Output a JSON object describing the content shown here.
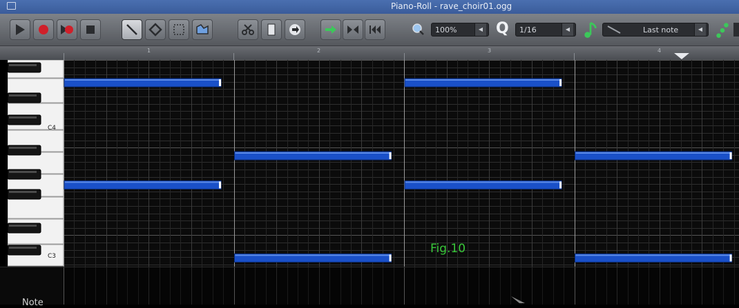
{
  "window": {
    "title": "Piano-Roll - rave_choir01.ogg"
  },
  "toolbar": {
    "buttons": [
      {
        "name": "play-button",
        "icon": "play-icon"
      },
      {
        "name": "record-button",
        "icon": "record-icon"
      },
      {
        "name": "record-while-playing-button",
        "icon": "record-play-icon"
      },
      {
        "name": "stop-button",
        "icon": "stop-icon"
      },
      {
        "name": "draw-mode-button",
        "icon": "pencil-icon"
      },
      {
        "name": "erase-mode-button",
        "icon": "eraser-icon"
      },
      {
        "name": "select-mode-button",
        "icon": "selection-icon"
      },
      {
        "name": "detune-mode-button",
        "icon": "automation-icon"
      },
      {
        "name": "cut-button",
        "icon": "scissors-icon"
      },
      {
        "name": "copy-button",
        "icon": "copy-icon"
      },
      {
        "name": "paste-button",
        "icon": "paste-icon"
      },
      {
        "name": "export-arrow-button",
        "icon": "arrow-right-icon"
      },
      {
        "name": "mirror-button",
        "icon": "mirror-icon"
      },
      {
        "name": "rewind-button",
        "icon": "rewind-icon"
      }
    ],
    "zoom_value": "100%",
    "quantize_value": "1/16",
    "note_length_value": "Last note"
  },
  "ruler": {
    "bars": [
      "1",
      "2",
      "3",
      "4"
    ]
  },
  "keyboard": {
    "octave_labels": [
      "C4",
      "C3"
    ]
  },
  "piano_roll": {
    "figure_label": "Fig.10",
    "note_color": "#1a50c8",
    "notes": [
      {
        "row": 5,
        "start": 0,
        "length": 15
      },
      {
        "row": 5,
        "start": 32,
        "length": 15
      },
      {
        "row": 15,
        "start": 16,
        "length": 15
      },
      {
        "row": 15,
        "start": 48,
        "length": 15
      },
      {
        "row": 19,
        "start": 0,
        "length": 15
      },
      {
        "row": 19,
        "start": 32,
        "length": 15
      },
      {
        "row": 29,
        "start": 16,
        "length": 15
      },
      {
        "row": 29,
        "start": 48,
        "length": 15
      }
    ]
  },
  "lower_panel": {
    "label": "Note"
  }
}
